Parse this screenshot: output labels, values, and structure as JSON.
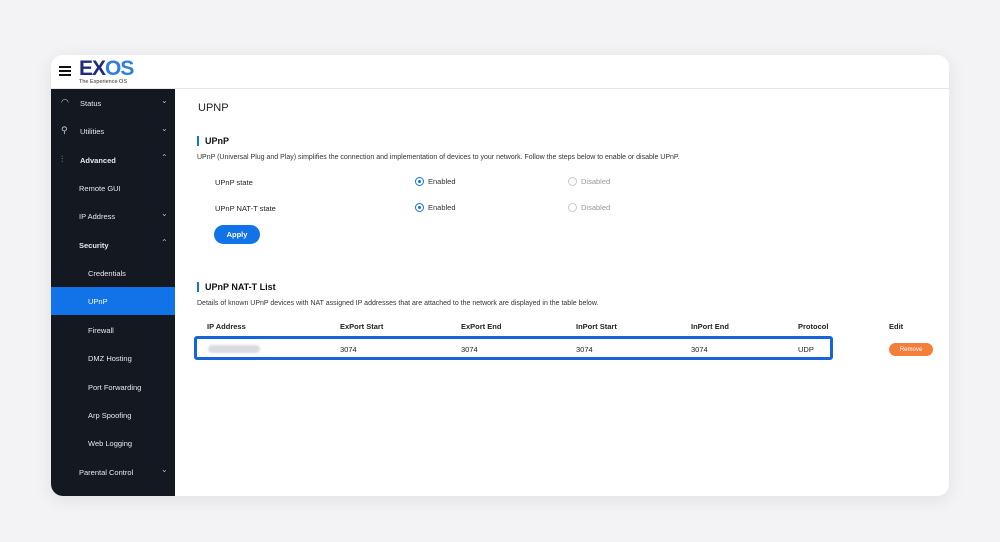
{
  "logo": {
    "brand_ex": "EX",
    "brand_os": "OS",
    "tagline": "The Experience OS"
  },
  "sidebar": {
    "items": [
      {
        "label": "Status",
        "icon": "gauge-icon"
      },
      {
        "label": "Utilities",
        "icon": "wrench-icon"
      },
      {
        "label": "Advanced",
        "icon": "sliders-icon"
      },
      {
        "label": "Remote GUI"
      },
      {
        "label": "IP Address"
      },
      {
        "label": "Security"
      },
      {
        "label": "Credentials"
      },
      {
        "label": "UPnP"
      },
      {
        "label": "Firewall"
      },
      {
        "label": "DMZ Hosting"
      },
      {
        "label": "Port Forwarding"
      },
      {
        "label": "Arp Spoofing"
      },
      {
        "label": "Web Logging"
      },
      {
        "label": "Parental Control"
      }
    ]
  },
  "main": {
    "page_title": "UPNP",
    "upnp": {
      "heading": "UPnP",
      "description": "UPnP (Universal Plug and Play) simplifies the connection and implementation of devices to your network. Follow the steps below to enable or disable UPnP.",
      "state_label": "UPnP state",
      "natt_label": "UPnP NAT-T state",
      "enabled": "Enabled",
      "disabled": "Disabled",
      "apply": "Apply"
    },
    "natt_list": {
      "heading": "UPnP NAT-T List",
      "description": "Details of known UPnP devices with NAT assigned IP addresses that are attached to the network are displayed in the table below.",
      "columns": [
        "IP Address",
        "ExPort Start",
        "ExPort End",
        "InPort Start",
        "InPort End",
        "Protocol",
        "Edit"
      ],
      "rows": [
        {
          "export_start": "3074",
          "export_end": "3074",
          "inport_start": "3074",
          "inport_end": "3074",
          "protocol": "UDP",
          "edit": "Remove"
        }
      ]
    }
  },
  "colors": {
    "accent": "#1272e8",
    "sidebar_bg": "#141820",
    "remove": "#f47f3b",
    "highlight": "#1565d8"
  }
}
